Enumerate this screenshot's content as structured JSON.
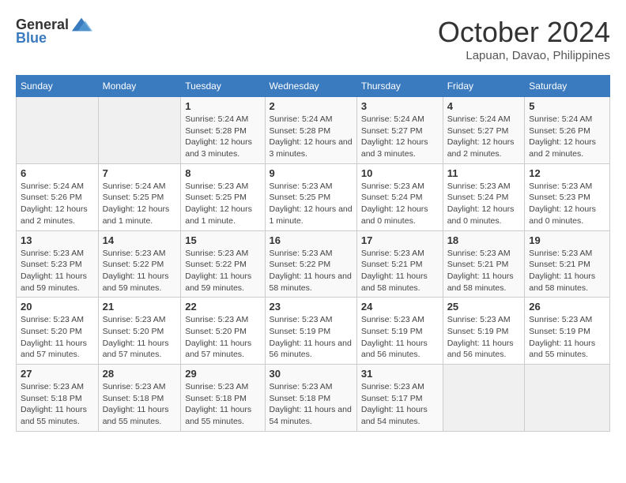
{
  "header": {
    "logo_general": "General",
    "logo_blue": "Blue",
    "month": "October 2024",
    "location": "Lapuan, Davao, Philippines"
  },
  "days_of_week": [
    "Sunday",
    "Monday",
    "Tuesday",
    "Wednesday",
    "Thursday",
    "Friday",
    "Saturday"
  ],
  "weeks": [
    [
      {
        "day": "",
        "info": ""
      },
      {
        "day": "",
        "info": ""
      },
      {
        "day": "1",
        "info": "Sunrise: 5:24 AM\nSunset: 5:28 PM\nDaylight: 12 hours and 3 minutes."
      },
      {
        "day": "2",
        "info": "Sunrise: 5:24 AM\nSunset: 5:28 PM\nDaylight: 12 hours and 3 minutes."
      },
      {
        "day": "3",
        "info": "Sunrise: 5:24 AM\nSunset: 5:27 PM\nDaylight: 12 hours and 3 minutes."
      },
      {
        "day": "4",
        "info": "Sunrise: 5:24 AM\nSunset: 5:27 PM\nDaylight: 12 hours and 2 minutes."
      },
      {
        "day": "5",
        "info": "Sunrise: 5:24 AM\nSunset: 5:26 PM\nDaylight: 12 hours and 2 minutes."
      }
    ],
    [
      {
        "day": "6",
        "info": "Sunrise: 5:24 AM\nSunset: 5:26 PM\nDaylight: 12 hours and 2 minutes."
      },
      {
        "day": "7",
        "info": "Sunrise: 5:24 AM\nSunset: 5:25 PM\nDaylight: 12 hours and 1 minute."
      },
      {
        "day": "8",
        "info": "Sunrise: 5:23 AM\nSunset: 5:25 PM\nDaylight: 12 hours and 1 minute."
      },
      {
        "day": "9",
        "info": "Sunrise: 5:23 AM\nSunset: 5:25 PM\nDaylight: 12 hours and 1 minute."
      },
      {
        "day": "10",
        "info": "Sunrise: 5:23 AM\nSunset: 5:24 PM\nDaylight: 12 hours and 0 minutes."
      },
      {
        "day": "11",
        "info": "Sunrise: 5:23 AM\nSunset: 5:24 PM\nDaylight: 12 hours and 0 minutes."
      },
      {
        "day": "12",
        "info": "Sunrise: 5:23 AM\nSunset: 5:23 PM\nDaylight: 12 hours and 0 minutes."
      }
    ],
    [
      {
        "day": "13",
        "info": "Sunrise: 5:23 AM\nSunset: 5:23 PM\nDaylight: 11 hours and 59 minutes."
      },
      {
        "day": "14",
        "info": "Sunrise: 5:23 AM\nSunset: 5:22 PM\nDaylight: 11 hours and 59 minutes."
      },
      {
        "day": "15",
        "info": "Sunrise: 5:23 AM\nSunset: 5:22 PM\nDaylight: 11 hours and 59 minutes."
      },
      {
        "day": "16",
        "info": "Sunrise: 5:23 AM\nSunset: 5:22 PM\nDaylight: 11 hours and 58 minutes."
      },
      {
        "day": "17",
        "info": "Sunrise: 5:23 AM\nSunset: 5:21 PM\nDaylight: 11 hours and 58 minutes."
      },
      {
        "day": "18",
        "info": "Sunrise: 5:23 AM\nSunset: 5:21 PM\nDaylight: 11 hours and 58 minutes."
      },
      {
        "day": "19",
        "info": "Sunrise: 5:23 AM\nSunset: 5:21 PM\nDaylight: 11 hours and 58 minutes."
      }
    ],
    [
      {
        "day": "20",
        "info": "Sunrise: 5:23 AM\nSunset: 5:20 PM\nDaylight: 11 hours and 57 minutes."
      },
      {
        "day": "21",
        "info": "Sunrise: 5:23 AM\nSunset: 5:20 PM\nDaylight: 11 hours and 57 minutes."
      },
      {
        "day": "22",
        "info": "Sunrise: 5:23 AM\nSunset: 5:20 PM\nDaylight: 11 hours and 57 minutes."
      },
      {
        "day": "23",
        "info": "Sunrise: 5:23 AM\nSunset: 5:19 PM\nDaylight: 11 hours and 56 minutes."
      },
      {
        "day": "24",
        "info": "Sunrise: 5:23 AM\nSunset: 5:19 PM\nDaylight: 11 hours and 56 minutes."
      },
      {
        "day": "25",
        "info": "Sunrise: 5:23 AM\nSunset: 5:19 PM\nDaylight: 11 hours and 56 minutes."
      },
      {
        "day": "26",
        "info": "Sunrise: 5:23 AM\nSunset: 5:19 PM\nDaylight: 11 hours and 55 minutes."
      }
    ],
    [
      {
        "day": "27",
        "info": "Sunrise: 5:23 AM\nSunset: 5:18 PM\nDaylight: 11 hours and 55 minutes."
      },
      {
        "day": "28",
        "info": "Sunrise: 5:23 AM\nSunset: 5:18 PM\nDaylight: 11 hours and 55 minutes."
      },
      {
        "day": "29",
        "info": "Sunrise: 5:23 AM\nSunset: 5:18 PM\nDaylight: 11 hours and 55 minutes."
      },
      {
        "day": "30",
        "info": "Sunrise: 5:23 AM\nSunset: 5:18 PM\nDaylight: 11 hours and 54 minutes."
      },
      {
        "day": "31",
        "info": "Sunrise: 5:23 AM\nSunset: 5:17 PM\nDaylight: 11 hours and 54 minutes."
      },
      {
        "day": "",
        "info": ""
      },
      {
        "day": "",
        "info": ""
      }
    ]
  ]
}
